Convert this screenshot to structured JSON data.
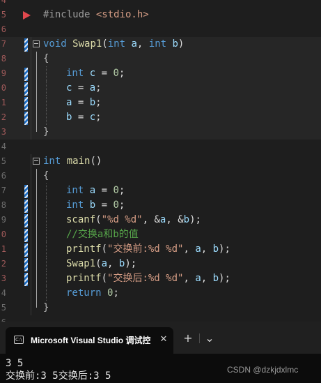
{
  "editor": {
    "line_numbers": {
      "l1": "4",
      "l2": "5",
      "l3": "6",
      "l4": "7",
      "l5": "8",
      "l6": "9",
      "l7": "0",
      "l8": "1",
      "l9": "2",
      "l10": "3",
      "l11": "4",
      "l12": "5",
      "l13": "6",
      "l14": "7",
      "l15": "8",
      "l16": "9",
      "l17": "0",
      "l18": "1",
      "l19": "2",
      "l20": "3",
      "l21": "4",
      "l22": "5",
      "l23": "6"
    },
    "code": {
      "include_directive": "#include ",
      "include_header": "<stdio.h>",
      "swap_kw": "void",
      "swap_name": "Swap1",
      "swap_paren_open": "(",
      "swap_int1": "int",
      "swap_a": " a",
      "swap_comma": ", ",
      "swap_int2": "int",
      "swap_b": " b",
      "swap_paren_close": ")",
      "brace_open": "{",
      "brace_close": "}",
      "l1_type": "int",
      "l1_var": " c",
      "l1_op": " = ",
      "l1_num": "0",
      "l1_semi": ";",
      "l2_lhs": "c",
      "l2_op": " = ",
      "l2_rhs": "a",
      "l2_semi": ";",
      "l3_lhs": "a",
      "l3_op": " = ",
      "l3_rhs": "b",
      "l3_semi": ";",
      "l4_lhs": "b",
      "l4_op": " = ",
      "l4_rhs": "c",
      "l4_semi": ";",
      "main_type": "int",
      "main_name": " main",
      "main_parens": "()",
      "m1_type": "int",
      "m1_var": " a",
      "m1_op": " = ",
      "m1_num": "0",
      "m1_semi": ";",
      "m2_type": "int",
      "m2_var": " b",
      "m2_op": " = ",
      "m2_num": "0",
      "m2_semi": ";",
      "m3_fn": "scanf",
      "m3_open": "(",
      "m3_str": "\"%d %d\"",
      "m3_args_a_amp": ", &",
      "m3_args_a": "a",
      "m3_args_b_amp": ", &",
      "m3_args_b": "b",
      "m3_close": ");",
      "m4_comment": "//交换a和b的值",
      "m5_fn": "printf",
      "m5_open": "(",
      "m5_str": "\"交换前:%d %d\"",
      "m5_sep1": ", ",
      "m5_a": "a",
      "m5_sep2": ", ",
      "m5_b": "b",
      "m5_close": ");",
      "m6_fn": "Swap1",
      "m6_open": "(",
      "m6_a": "a",
      "m6_sep": ", ",
      "m6_b": "b",
      "m6_close": ");",
      "m7_fn": "printf",
      "m7_open": "(",
      "m7_str": "\"交换后:%d %d\"",
      "m7_sep1": ", ",
      "m7_a": "a",
      "m7_sep2": ", ",
      "m7_b": "b",
      "m7_close": ");",
      "m8_kw": "return",
      "m8_num": " 0",
      "m8_semi": ";"
    }
  },
  "console": {
    "tab_title": "Microsoft Visual Studio 调试控制台",
    "icon_text": "C:\\",
    "close_glyph": "✕",
    "new_tab_glyph": "+",
    "dropdown_glyph": "⌄",
    "output_line1": "3 5",
    "output_line2": "交换前:3 5交换后:3 5",
    "watermark": "CSDN @dzkjdxlmc"
  },
  "colors": {
    "keyword": "#569cd6",
    "function": "#dcdcaa",
    "variable": "#9cdcfe",
    "number": "#b5cea8",
    "string": "#d69d85",
    "comment": "#57a64a",
    "breakpoint_arrow": "#e0484d"
  }
}
